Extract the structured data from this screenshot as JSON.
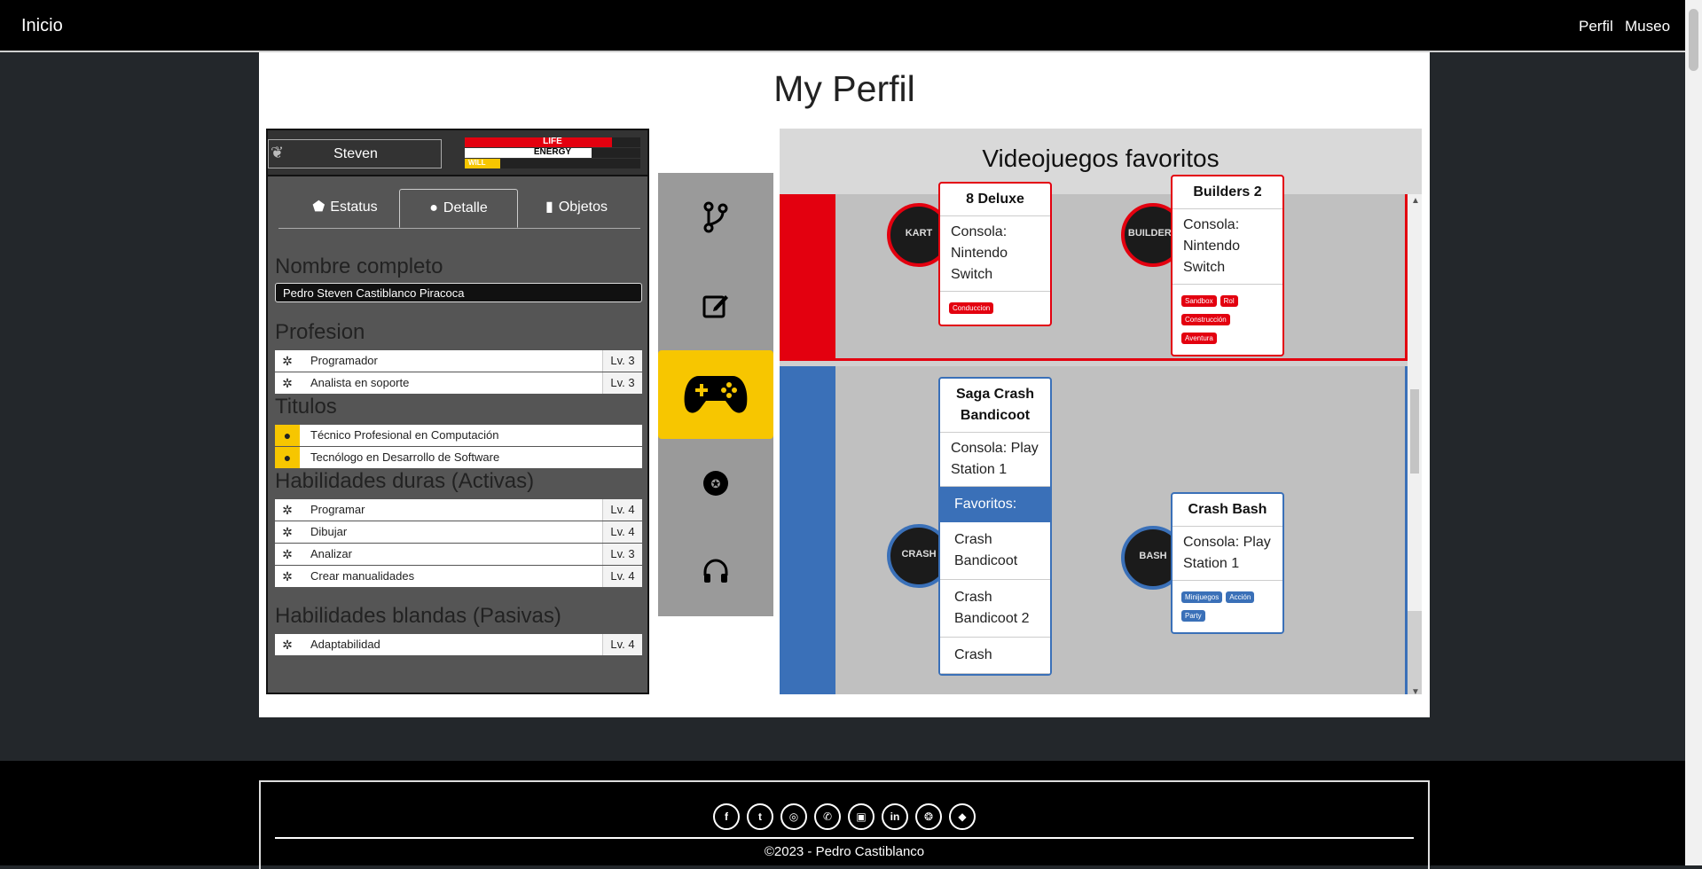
{
  "navbar": {
    "brand": "Inicio",
    "links": [
      "Perfil",
      "Museo"
    ]
  },
  "page": {
    "title": "My Perfil"
  },
  "profile": {
    "name": "Steven",
    "bars": [
      {
        "label": "LIFE",
        "color": "#e3000f",
        "percent": 84
      },
      {
        "label": "ENERGY",
        "color": "#ffffff",
        "percent": 72
      },
      {
        "label": "WILL",
        "color": "#f7c600",
        "percent": 20
      }
    ],
    "tabs": [
      "Estatus",
      "Detalle",
      "Objetos"
    ],
    "active_tab": "Detalle",
    "sections": {
      "full_name_title": "Nombre completo",
      "full_name": "Pedro Steven Castiblanco Piracoca",
      "profession_title": "Profesion",
      "titles_title": "Titulos",
      "hard_title": "Habilidades duras (Activas)",
      "soft_title": "Habilidades blandas (Pasivas)"
    },
    "professions": [
      {
        "label": "Programador",
        "level": "Lv. 3"
      },
      {
        "label": "Analista en soporte",
        "level": "Lv. 3"
      }
    ],
    "titles": [
      {
        "label": "Técnico Profesional en Computación"
      },
      {
        "label": "Tecnólogo en Desarrollo de Software"
      }
    ],
    "hard_skills": [
      {
        "label": "Programar",
        "level": "Lv. 4"
      },
      {
        "label": "Dibujar",
        "level": "Lv. 4"
      },
      {
        "label": "Analizar",
        "level": "Lv. 3"
      },
      {
        "label": "Crear manualidades",
        "level": "Lv. 4"
      }
    ],
    "soft_skills": [
      {
        "label": "Adaptabilidad",
        "level": "Lv. 4"
      }
    ]
  },
  "menu_icons": [
    "git-branch-icon",
    "edit-icon",
    "gamepad-icon",
    "globe-icon",
    "headset-icon"
  ],
  "favorites": {
    "title": "Videojuegos favoritos",
    "colors": {
      "red": "#e3000f",
      "blue": "#3a70b8"
    },
    "red_group": {
      "card1": {
        "title": "8 Deluxe",
        "console": "Consola: Nintendo Switch",
        "tags": [
          "Conduccion"
        ],
        "avatar": "KART"
      },
      "card2": {
        "title": "Builders 2",
        "console": "Consola: Nintendo Switch",
        "tags": [
          "Sandbox",
          "Rol",
          "Construcción",
          "Aventura"
        ],
        "avatar": "BUILDERS"
      }
    },
    "blue_group": {
      "card1": {
        "title": "Saga Crash Bandicoot",
        "console": "Consola: Play Station 1",
        "list_header": "Favoritos:",
        "list": [
          "Crash Bandicoot",
          "Crash Bandicoot 2",
          "Crash"
        ],
        "avatar": "CRASH"
      },
      "card2": {
        "title": "Crash Bash",
        "console": "Consola: Play Station 1",
        "tags": [
          "Minijuegos",
          "Acción",
          "Party"
        ],
        "avatar": "BASH"
      }
    }
  },
  "footer": {
    "social": [
      "facebook-icon",
      "twitter-icon",
      "instagram-icon",
      "whatsapp-icon",
      "twitch-icon",
      "linkedin-icon",
      "github-icon",
      "gitlab-icon"
    ],
    "social_glyphs": [
      "f",
      "t",
      "◎",
      "✆",
      "▣",
      "in",
      "❂",
      "◆"
    ],
    "copyright": "©2023 - Pedro Castiblanco"
  }
}
